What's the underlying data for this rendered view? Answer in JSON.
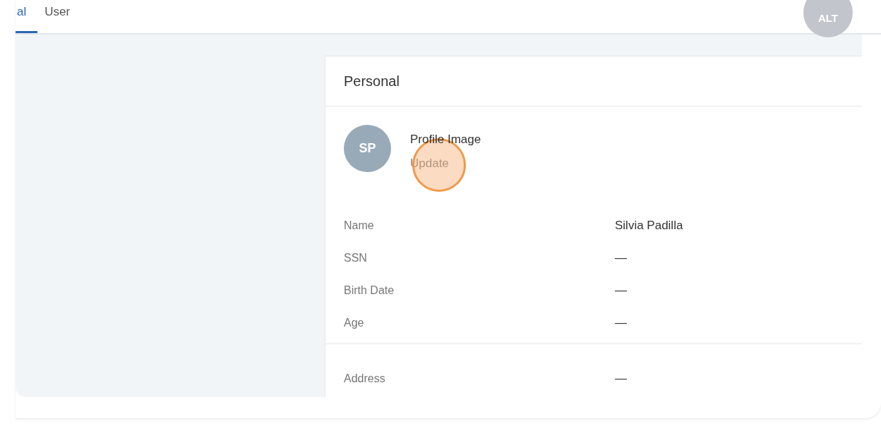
{
  "tabs": [
    {
      "label": "al",
      "selected": true
    },
    {
      "label": "User",
      "selected": false
    }
  ],
  "user_avatar": {
    "initials": "ALT"
  },
  "card": {
    "title": "Personal",
    "profile": {
      "initials": "SP",
      "label": "Profile Image",
      "action": "Update"
    },
    "sections": [
      [
        {
          "label": "Name",
          "value": "Silvia Padilla"
        },
        {
          "label": "SSN",
          "value": "—"
        },
        {
          "label": "Birth Date",
          "value": "—"
        },
        {
          "label": "Age",
          "value": "—"
        }
      ],
      [
        {
          "label": "Address",
          "value": "—"
        }
      ]
    ]
  }
}
